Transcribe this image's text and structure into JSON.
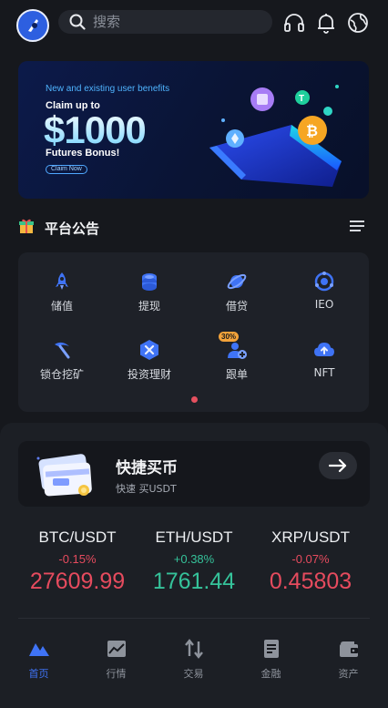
{
  "search": {
    "placeholder": "搜索"
  },
  "icons": {
    "header": [
      "headset-icon",
      "bell-icon",
      "globe-icon"
    ]
  },
  "banner": {
    "subtitle": "New and existing user benefits",
    "claim_text": "Claim up to",
    "amount": "$1000",
    "bonus_text": "Futures Bonus!",
    "button_label": "Claim Now"
  },
  "notice": {
    "title": "平台公告"
  },
  "services": {
    "items": [
      {
        "label": "储值",
        "icon": "rocket-icon"
      },
      {
        "label": "提现",
        "icon": "coin-stack-icon"
      },
      {
        "label": "借贷",
        "icon": "planet-icon"
      },
      {
        "label": "IEO",
        "icon": "target-icon"
      },
      {
        "label": "锁仓挖矿",
        "icon": "pickaxe-icon"
      },
      {
        "label": "投资理财",
        "icon": "hexagon-icon"
      },
      {
        "label": "跟单",
        "icon": "follow-user-icon",
        "badge": "30%"
      },
      {
        "label": "NFT",
        "icon": "cloud-upload-icon"
      }
    ]
  },
  "quick_buy": {
    "title": "快捷买币",
    "subtitle": "快速 买USDT"
  },
  "tickers": [
    {
      "pair": "BTC/USDT",
      "change": "-0.15%",
      "price": "27609.99",
      "direction": "down"
    },
    {
      "pair": "ETH/USDT",
      "change": "+0.38%",
      "price": "1761.44",
      "direction": "up"
    },
    {
      "pair": "XRP/USDT",
      "change": "-0.07%",
      "price": "0.45803",
      "direction": "down"
    }
  ],
  "tabs": [
    {
      "label": "首页",
      "icon": "home-icon",
      "active": true
    },
    {
      "label": "行情",
      "icon": "chart-icon",
      "active": false
    },
    {
      "label": "交易",
      "icon": "swap-arrows-icon",
      "active": false
    },
    {
      "label": "金融",
      "icon": "document-icon",
      "active": false
    },
    {
      "label": "资产",
      "icon": "wallet-icon",
      "active": false
    }
  ],
  "colors": {
    "background": "#16181d",
    "accent": "#3f73f5",
    "down": "#e64b5e",
    "up": "#35c29a"
  }
}
